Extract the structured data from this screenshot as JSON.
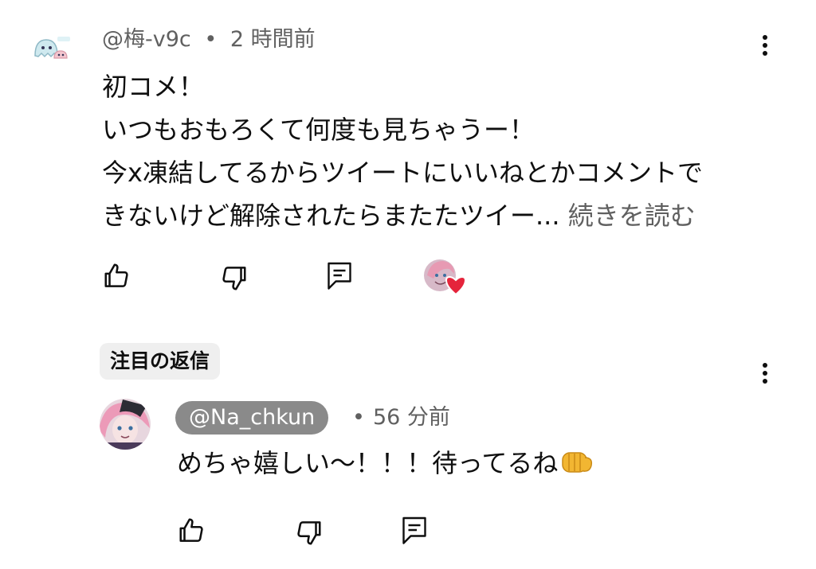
{
  "comment": {
    "author": "@梅-v9c",
    "separator": "•",
    "time": "2 時間前",
    "lines": [
      "初コメ！",
      "いつもおもろくて何度も見ちゃうー！",
      "今x凍結してるからツイートにいいねとかコメントで",
      "きないけど解除されたらまたたツイー..."
    ],
    "read_more": "続きを読む",
    "avatar_icon": "ghost-avatar-icon",
    "actions": [
      "like-icon",
      "dislike-icon",
      "reply-icon",
      "creator-heart-icon"
    ]
  },
  "highlighted_reply_label": "注目の返信",
  "reply": {
    "author": "@Na_chkun",
    "separator": "•",
    "time": "56 分前",
    "text": "めちゃ嬉しい〜！！！待ってるね",
    "emoji_icon": "fist-bump-icon",
    "actions": [
      "like-icon",
      "dislike-icon",
      "reply-icon"
    ]
  },
  "colors": {
    "text": "#0f0f0f",
    "secondary": "#606060",
    "chip_bg": "#efefef",
    "owner_badge_bg": "#8a8a8a",
    "heart": "#e5243b"
  }
}
